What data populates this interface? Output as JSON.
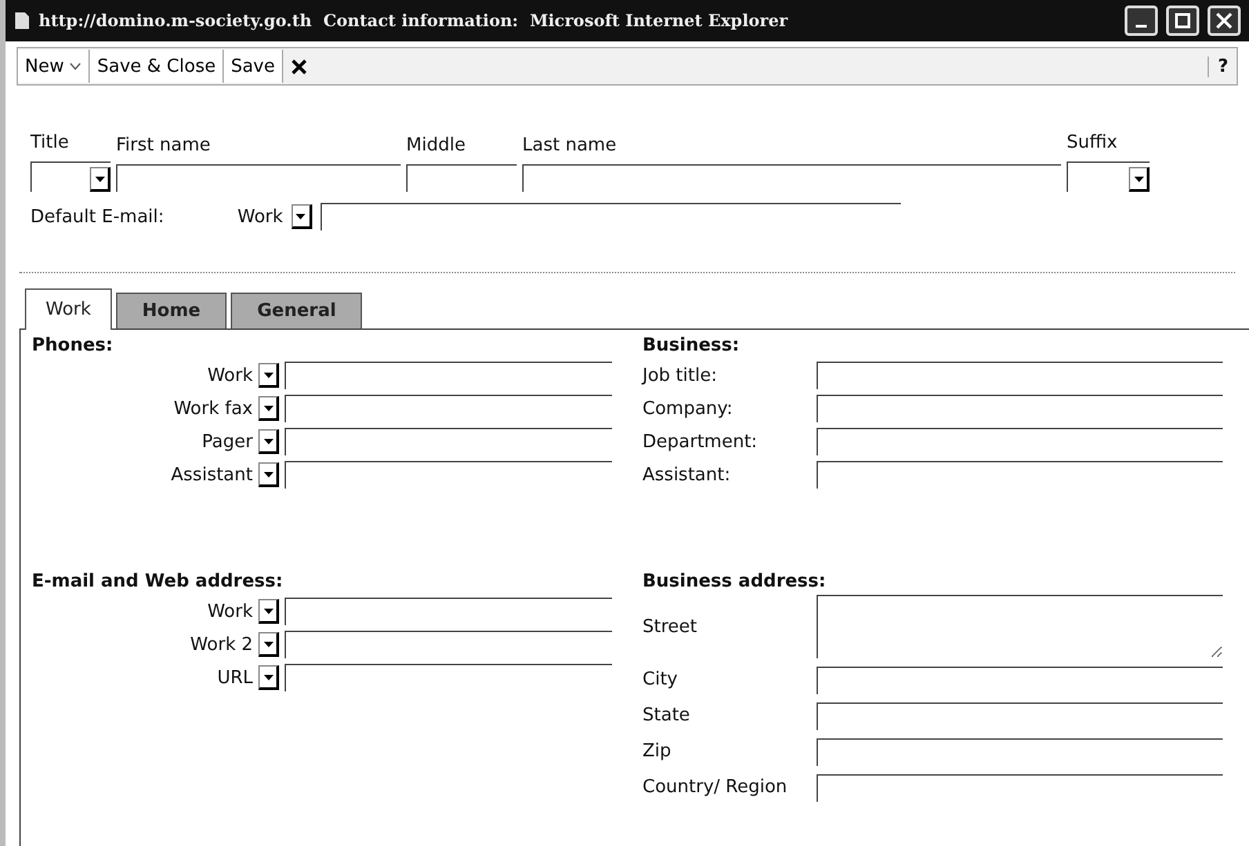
{
  "window": {
    "title": "http://domino.m-society.go.th  Contact information:  Microsoft Internet Explorer"
  },
  "toolbar": {
    "buttons": [
      {
        "label": "New",
        "kind": "menu"
      },
      {
        "label": "Save & Close",
        "kind": "plain"
      },
      {
        "label": "Save",
        "kind": "plain"
      },
      {
        "kind": "close"
      }
    ],
    "help": "?"
  },
  "name_fields": [
    {
      "label": "Title",
      "kind": "select"
    },
    {
      "label": "First name",
      "kind": "text"
    },
    {
      "label": "Middle",
      "kind": "text"
    },
    {
      "label": "Last name",
      "kind": "text"
    },
    {
      "label": "Suffix",
      "kind": "select"
    }
  ],
  "default_email": {
    "label": "Default E-mail:",
    "type": "Work"
  },
  "tabs": [
    {
      "label": "Work",
      "selected": true
    },
    {
      "label": "Home",
      "selected": false
    },
    {
      "label": "General",
      "selected": false
    }
  ],
  "phones": {
    "title": "Phones:",
    "rows": [
      {
        "type": "Work"
      },
      {
        "type": "Work fax"
      },
      {
        "type": "Pager"
      },
      {
        "type": "Assistant"
      }
    ]
  },
  "email_web": {
    "title": "E-mail and Web address:",
    "rows": [
      {
        "type": "Work"
      },
      {
        "type": "Work 2"
      },
      {
        "type": "URL"
      }
    ]
  },
  "business": {
    "title": "Business:",
    "fields": [
      {
        "label": "Job title:"
      },
      {
        "label": "Company:"
      },
      {
        "label": "Department:"
      },
      {
        "label": "Assistant:"
      }
    ]
  },
  "business_address": {
    "title": "Business address:",
    "fields": [
      {
        "label": "Street",
        "kind": "tall"
      },
      {
        "label": "City",
        "kind": "text"
      },
      {
        "label": "State",
        "kind": "text"
      },
      {
        "label": "Zip",
        "kind": "text"
      },
      {
        "label": "Country/ Region",
        "kind": "text"
      }
    ]
  }
}
